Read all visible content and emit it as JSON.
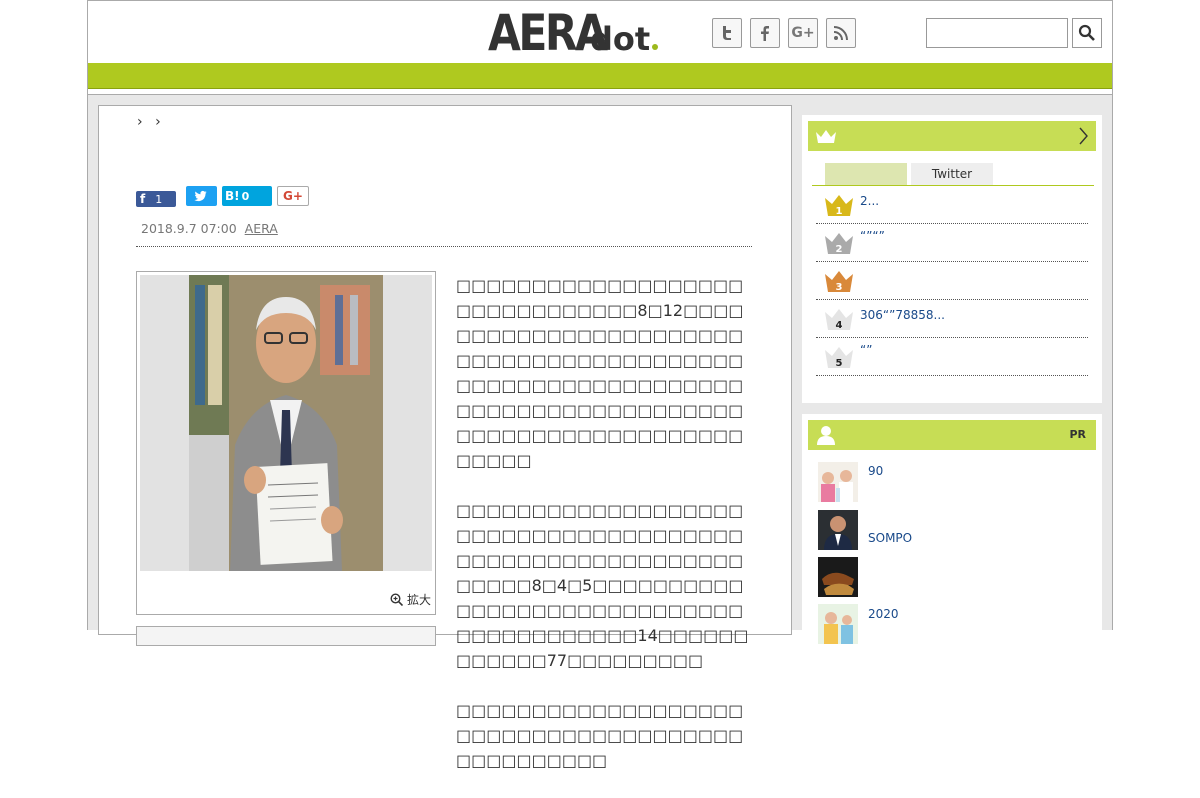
{
  "header": {
    "logo_main": "AERA",
    "logo_sub": "dot",
    "social": [
      {
        "name": "twitter-icon",
        "glyph": "t"
      },
      {
        "name": "facebook-icon",
        "glyph": "f"
      },
      {
        "name": "google-plus-icon",
        "glyph": "G+"
      },
      {
        "name": "rss-icon",
        "glyph": "◉"
      }
    ],
    "search_placeholder": "",
    "colors": {
      "accent": "#afc91f",
      "accent_light": "#c7dd55"
    }
  },
  "article": {
    "breadcrumb_sep1": "›",
    "breadcrumb_sep2": "›",
    "share": {
      "facebook_count": "1",
      "hatena_label": "B!",
      "hatena_count": "0",
      "gplus_label": "G+"
    },
    "date": "2018.9.7 07:00",
    "source": "AERA",
    "enlarge_label": "拡大",
    "paragraphs": [
      "□□□□□□□□□□□□□□□□□□□□□□□□□□□□□□□8□12□□□□□□□□□□□□□□□□□□□□□□□□□□□□□□□□□□□□□□□□□□□□□□□□□□□□□□□□□□□□□□□□□□□□□□□□□□□□□□□□□□□□□□□□□□□□□□□□□□□□□□□□",
      "□□□□□□□□□□□□□□□□□□□□□□□□□□□□□□□□□□□□□□□□□□□□□□□□□□□□□□□□□□□□□□8□4□5□□□□□□□□□□□□□□□□□□□□□□□□□□□□□□□□□□□□□□□□□14□□□□□□□□□□□□77□□□□□□□□□",
      "□□□□□□□□□□□□□□□□□□□□□□□□□□□□□□□□□□□□□□□□□□□□□□□□"
    ]
  },
  "ranking": {
    "tabs": [
      "",
      "Twitter"
    ],
    "items": [
      {
        "rank": "1",
        "title": "2...",
        "color": "#d8b81a"
      },
      {
        "rank": "2",
        "title": "“”“”",
        "color": "#aaaaaa"
      },
      {
        "rank": "3",
        "title": "",
        "color": "#d9893a"
      },
      {
        "rank": "4",
        "title": "306“”78858...",
        "color": "#e4e4e4"
      },
      {
        "rank": "5",
        "title": "“”",
        "color": "#e4e4e4"
      }
    ]
  },
  "pr": {
    "label": "PR",
    "items": [
      {
        "title": "90"
      },
      {
        "title": "SOMPO"
      },
      {
        "title": ""
      },
      {
        "title": "2020"
      }
    ]
  }
}
